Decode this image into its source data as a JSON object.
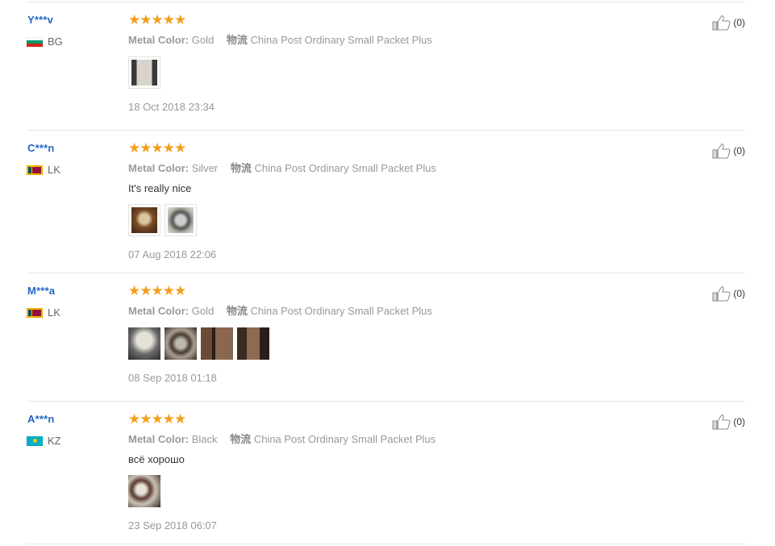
{
  "colors": {
    "user": "#2166c2",
    "stars": "#f49e1c",
    "meta": "#999999"
  },
  "reviews": [
    {
      "user": "Y***v",
      "country": "BG",
      "flag": "flag-bg",
      "stars": "★★★★★",
      "metal_label": "Metal Color:",
      "metal_value": "Gold",
      "ship_label": "物流",
      "ship_value": "China Post Ordinary Small Packet Plus",
      "text": "",
      "photos": 1,
      "date": "18 Oct 2018 23:34",
      "helpful": "(0)"
    },
    {
      "user": "C***n",
      "country": "LK",
      "flag": "flag-lk",
      "stars": "★★★★★",
      "metal_label": "Metal Color:",
      "metal_value": "Silver",
      "ship_label": "物流",
      "ship_value": "China Post Ordinary Small Packet Plus",
      "text": "It's really nice",
      "photos": 2,
      "date": "07 Aug 2018 22:06",
      "helpful": "(0)"
    },
    {
      "user": "M***a",
      "country": "LK",
      "flag": "flag-lk",
      "stars": "★★★★★",
      "metal_label": "Metal Color:",
      "metal_value": "Gold",
      "ship_label": "物流",
      "ship_value": "China Post Ordinary Small Packet Plus",
      "text": "",
      "photos": 4,
      "date": "08 Sep 2018 01:18",
      "helpful": "(0)"
    },
    {
      "user": "A***n",
      "country": "KZ",
      "flag": "flag-kz",
      "stars": "★★★★★",
      "metal_label": "Metal Color:",
      "metal_value": "Black",
      "ship_label": "物流",
      "ship_value": "China Post Ordinary Small Packet Plus",
      "text": "всё хорошо",
      "photos": 1,
      "date": "23 Sep 2018 06:07",
      "helpful": "(0)"
    }
  ]
}
